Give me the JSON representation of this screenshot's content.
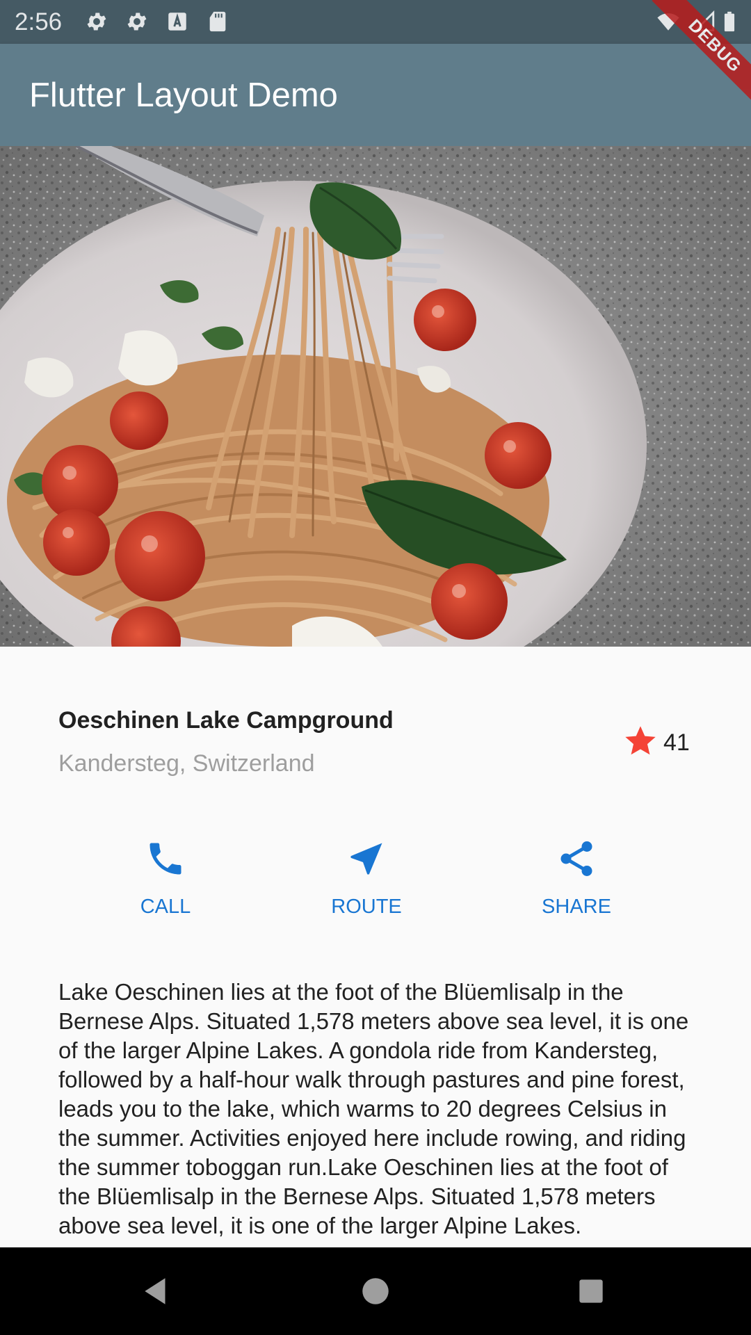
{
  "status_bar": {
    "time": "2:56",
    "left_icons": [
      "gear-icon",
      "gear-icon",
      "text-a-icon",
      "sd-card-icon"
    ],
    "right_icons": [
      "wifi-icon",
      "signal-icon",
      "battery-icon"
    ]
  },
  "debug_banner": "DEBUG",
  "app_bar": {
    "title": "Flutter Layout Demo",
    "color": "#607d8b"
  },
  "hero_image": {
    "subject": "spaghetti-pasta-on-fork-photo"
  },
  "title_section": {
    "name": "Oeschinen Lake Campground",
    "location": "Kandersteg, Switzerland",
    "star_count": "41",
    "star_color": "#f44336"
  },
  "buttons": [
    {
      "label": "CALL",
      "icon": "phone-icon"
    },
    {
      "label": "ROUTE",
      "icon": "near-me-icon"
    },
    {
      "label": "SHARE",
      "icon": "share-icon"
    }
  ],
  "accent_color": "#1976d2",
  "description": "Lake Oeschinen lies at the foot of the Blüemlisalp in the Bernese Alps. Situated 1,578 meters above sea level, it is one of the larger Alpine Lakes. A gondola ride from Kandersteg, followed by a half-hour walk through pastures and pine forest, leads you to the lake, which warms to 20 degrees Celsius in the summer. Activities enjoyed here include rowing, and riding the summer toboggan run.Lake Oeschinen lies at the foot of the Blüemlisalp in the Bernese Alps. Situated 1,578 meters above sea level, it is one of the larger Alpine Lakes.",
  "nav_bar": {
    "buttons": [
      "back-icon",
      "home-icon",
      "recents-icon"
    ]
  }
}
